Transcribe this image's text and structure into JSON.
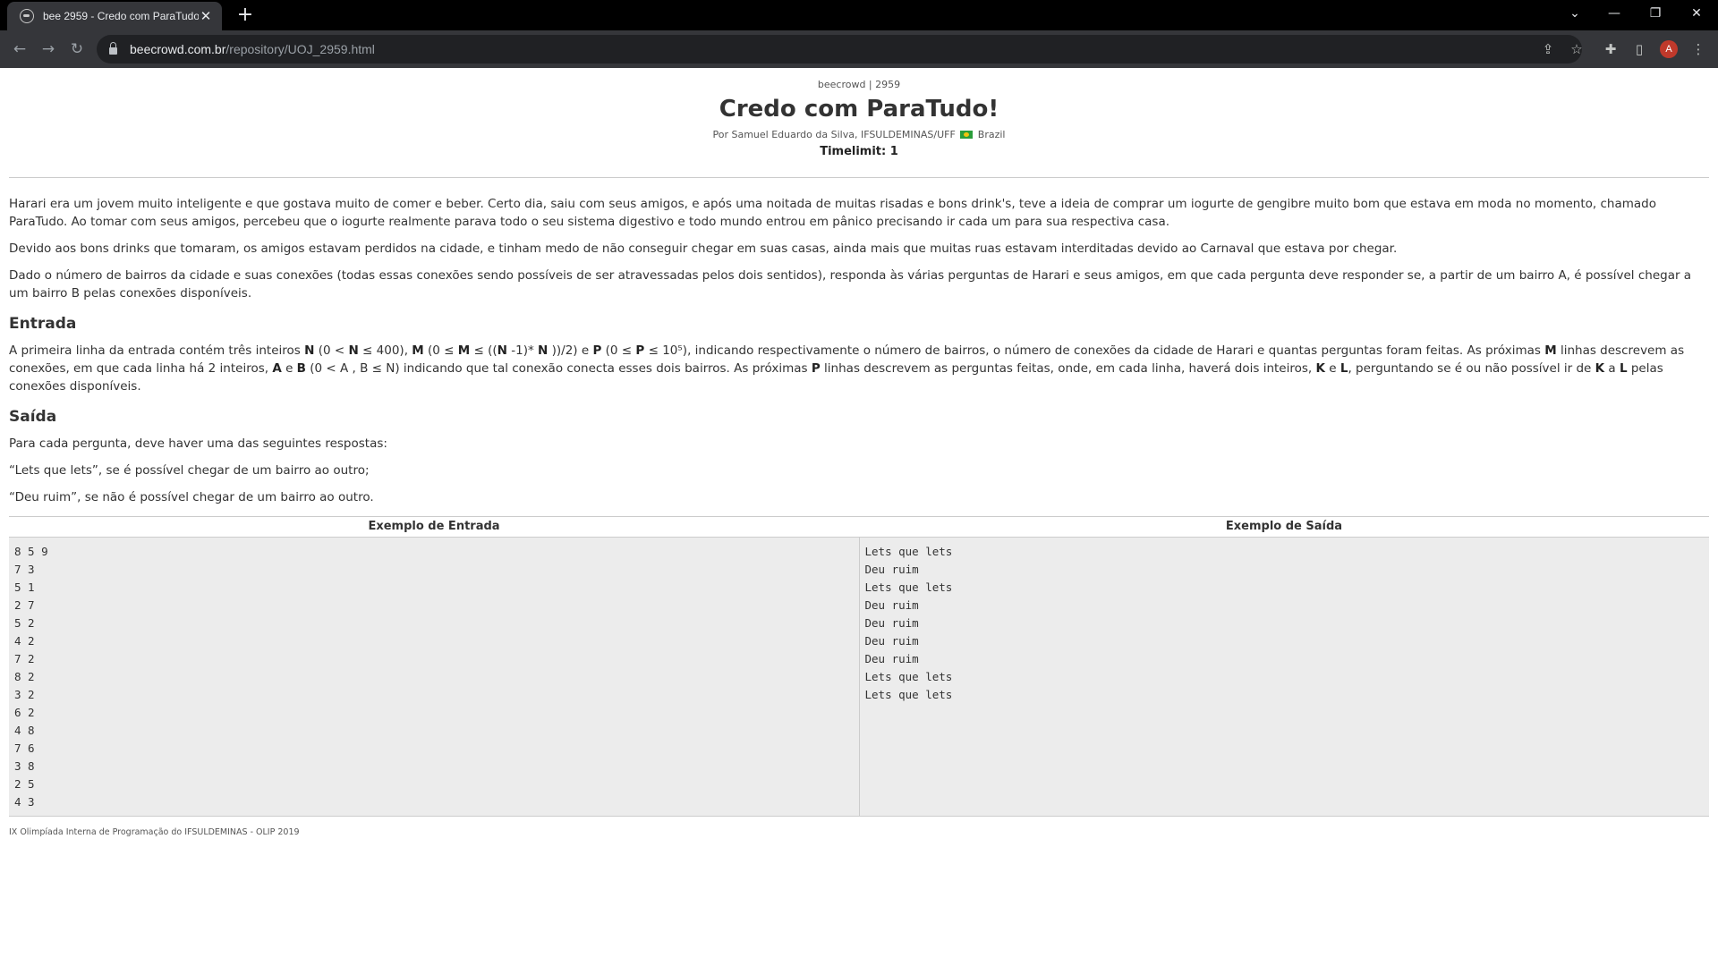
{
  "browser": {
    "tab_title": "bee 2959 - Credo com ParaTudo!",
    "url_domain": "beecrowd.com.br",
    "url_path": "/repository/UOJ_2959.html",
    "avatar_letter": "A"
  },
  "header": {
    "site": "beecrowd | 2959",
    "title": "Credo com ParaTudo!",
    "author_prefix": "Por Samuel Eduardo da Silva, IFSULDEMINAS/UFF",
    "author_country": "Brazil",
    "timelimit": "Timelimit: 1"
  },
  "description": {
    "p1": "Harari era um jovem muito inteligente e que gostava muito de comer e beber. Certo dia, saiu com seus amigos, e após uma noitada de muitas risadas e bons drink's, teve a ideia de comprar um iogurte de gengibre muito bom que estava em moda no momento, chamado ParaTudo. Ao tomar com seus amigos, percebeu que o iogurte realmente parava todo o seu sistema digestivo e todo mundo entrou em pânico precisando ir cada um para sua respectiva casa.",
    "p2": "Devido aos bons drinks que tomaram, os amigos estavam perdidos na cidade, e tinham medo de não conseguir chegar em suas casas, ainda mais que muitas ruas estavam interditadas devido ao Carnaval que estava por chegar.",
    "p3": "Dado o número de bairros da cidade e suas conexões (todas essas conexões sendo possíveis de ser atravessadas pelos dois sentidos), responda às várias perguntas de Harari e seus amigos, em que cada pergunta deve responder se, a partir de um bairro A, é possível chegar a um bairro B pelas conexões disponíveis."
  },
  "input_section": {
    "heading": "Entrada",
    "t1": "A primeira linha da entrada contém três inteiros ",
    "N": "N",
    "t2": " (0 < ",
    "t3": " ≤ 400), ",
    "M": "M",
    "t4": " (0 ≤ ",
    "t5": " ≤ ((",
    "t6": " -1)* ",
    "t7": " ))/2) e ",
    "P": "P",
    "t8": " (0 ≤ ",
    "t9": " ≤ 10⁵), indicando respectivamente o número de bairros, o número de conexões da cidade de Harari e quantas perguntas foram feitas. As próximas ",
    "t10": " linhas descrevem as conexões, em que cada linha há 2 inteiros, ",
    "A": "A",
    "t11": " e ",
    "B": "B",
    "t12": " (0 < A , B ≤ N) indicando que tal conexão conecta esses dois bairros. As próximas ",
    "t13": " linhas descrevem as perguntas feitas, onde, em cada linha, haverá dois inteiros, ",
    "K": "K",
    "t14": " e ",
    "L": "L",
    "t15": ", perguntando se é ou não possível ir de ",
    "t16": " a ",
    "t17": " pelas conexões disponíveis."
  },
  "output_section": {
    "heading": "Saída",
    "p1": "Para cada pergunta, deve haver uma das seguintes respostas:",
    "p2": "“Lets que lets”, se é possível chegar de um bairro ao outro;",
    "p3": "“Deu ruim”, se não é possível chegar de um bairro ao outro."
  },
  "examples": {
    "input_header": "Exemplo de Entrada",
    "output_header": "Exemplo de Saída",
    "input": "8 5 9\n7 3\n5 1\n2 7\n5 2\n4 2\n7 2\n8 2\n3 2\n6 2\n4 8\n7 6\n3 8\n2 5\n4 3",
    "output": "Lets que lets\nDeu ruim\nLets que lets\nDeu ruim\nDeu ruim\nDeu ruim\nDeu ruim\nLets que lets\nLets que lets"
  },
  "footer": "IX Olimpíada Interna de Programação do IFSULDEMINAS - OLIP 2019"
}
